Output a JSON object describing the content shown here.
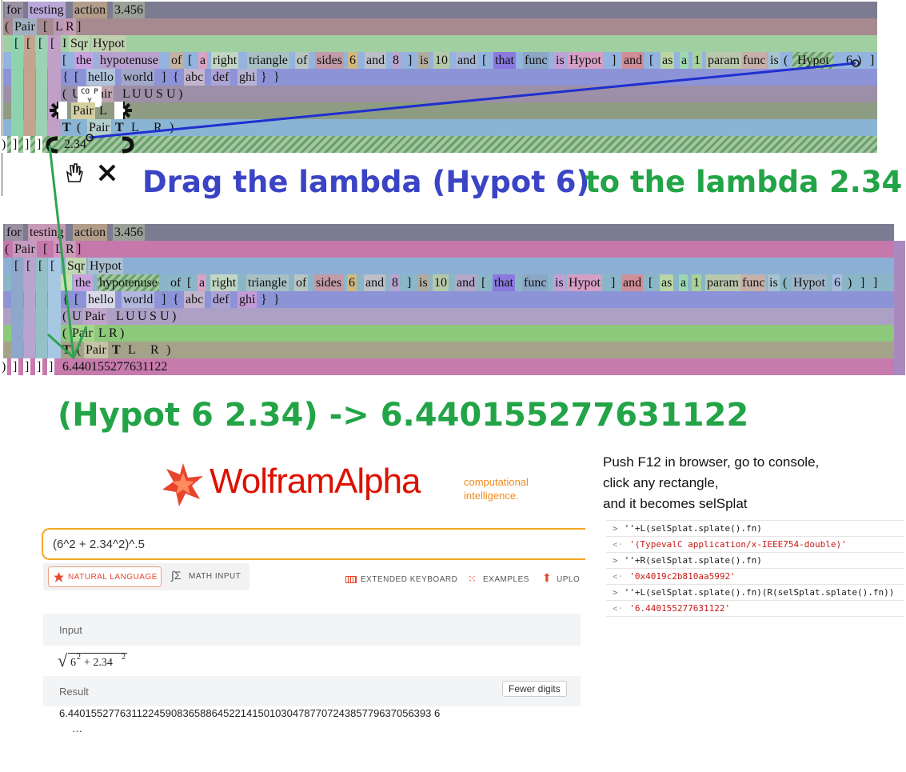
{
  "before": {
    "line1": [
      "for",
      "testing",
      "action",
      "3.456"
    ],
    "line2": [
      "(",
      "Pair",
      "[",
      "L",
      "R",
      "]"
    ],
    "line3_brackets": [
      "[",
      "[",
      "[",
      "["
    ],
    "line3": [
      "I",
      "Sqr",
      "Hypot"
    ],
    "line4": [
      "[",
      "the",
      "hypotenuse",
      "of",
      "[",
      "a",
      "right",
      "triangle",
      "of",
      "sides",
      "6",
      "and",
      "8",
      "]",
      "is",
      "10",
      "and",
      "[",
      "that",
      "func",
      "is",
      "Hypot",
      "]",
      "and",
      "[",
      "as",
      "a",
      "1",
      "param",
      "func",
      "is",
      "(",
      "Hypot",
      "6",
      ")",
      "]"
    ],
    "line5": [
      "{",
      "[",
      "hello",
      "world",
      "]",
      "{",
      "abc",
      "def",
      "ghi",
      "}",
      "}"
    ],
    "line6": [
      "(",
      "U",
      "Pair",
      "L",
      "U",
      "U",
      "S",
      "U",
      ")"
    ],
    "copy_label": "CO PY",
    "line7": [
      "Pair",
      "L"
    ],
    "line8": [
      "T",
      "(",
      "Pair",
      "T",
      "L",
      "R",
      ")"
    ],
    "line9_close": [
      ")",
      "]",
      "]",
      "]"
    ],
    "line9_value": "2.34"
  },
  "instruction": {
    "part1": "Drag the lambda (Hypot 6)",
    "part2": "to the lambda 2.34",
    "color1": "#3a44c4",
    "color2": "#22a447"
  },
  "after": {
    "line1": [
      "for",
      "testing",
      "action",
      "3.456"
    ],
    "line2": [
      "(",
      "Pair",
      "[",
      "L",
      "R",
      "]"
    ],
    "line3_brackets": [
      "[",
      "[",
      "[",
      "["
    ],
    "line3": [
      "Sqr",
      "Hypot"
    ],
    "line4": [
      "the",
      "hypotenuse",
      "of",
      "[",
      "a",
      "right",
      "triangle",
      "of",
      "sides",
      "6",
      "and",
      "8",
      "]",
      "is",
      "10",
      "and",
      "[",
      "that",
      "func",
      "is",
      "Hypot",
      "]",
      "and",
      "[",
      "as",
      "a",
      "1",
      "param",
      "func",
      "is",
      "(",
      "Hypot",
      "6",
      ")",
      "]",
      "]"
    ],
    "line5": [
      "{",
      "[",
      "hello",
      "world",
      "]",
      "{",
      "abc",
      "def",
      "ghi",
      "}",
      "}"
    ],
    "line6": [
      "(",
      "U",
      "Pair",
      "L",
      "U",
      "U",
      "S",
      "U",
      ")"
    ],
    "line7": [
      "(",
      "Pair",
      "L",
      "R",
      ")"
    ],
    "line8": [
      "T",
      "(",
      "Pair",
      "T",
      "L",
      "R",
      ")"
    ],
    "line9_close": [
      ")",
      "]",
      "]",
      "]",
      "]"
    ],
    "line9_value": "6.440155277631122"
  },
  "result_caption": "(Hypot 6 2.34) ->  6.440155277631122",
  "wolfram": {
    "logo_text": "WolframAlpha",
    "tagline1": "computational",
    "tagline2": "intelligence.",
    "query": "(6^2 + 2.34^2)^.5",
    "natural_language": "NATURAL LANGUAGE",
    "math_input": "MATH INPUT",
    "extended_keyboard": "EXTENDED KEYBOARD",
    "examples": "EXAMPLES",
    "upload": "UPLO",
    "input_label": "Input",
    "input_formula_a": "6",
    "input_formula_sup1": "2",
    "input_formula_b": "+ 2.34",
    "input_formula_sup2": "2",
    "result_label": "Result",
    "fewer_digits": "Fewer digits",
    "result_value": "6.440155277631122459083658864522141501030478770724385779637056393 6",
    "ellipsis": "…"
  },
  "console_note": {
    "line1": "Push F12 in browser, go to console,",
    "line2": "click any rectangle,",
    "line3": "and it becomes selSplat"
  },
  "console": [
    {
      "kind": "in",
      "text": "''+L(selSplat.splate().fn)"
    },
    {
      "kind": "out",
      "text": "'(TypevalC application/x-IEEE754-double)'"
    },
    {
      "kind": "in",
      "text": "''+R(selSplat.splate().fn)"
    },
    {
      "kind": "out",
      "text": "'0x4019c2b810aa5992'"
    },
    {
      "kind": "in",
      "text": "''+L(selSplat.splate().fn)(R(selSplat.splate().fn))"
    },
    {
      "kind": "out",
      "text": "'6.440155277631122'"
    }
  ]
}
